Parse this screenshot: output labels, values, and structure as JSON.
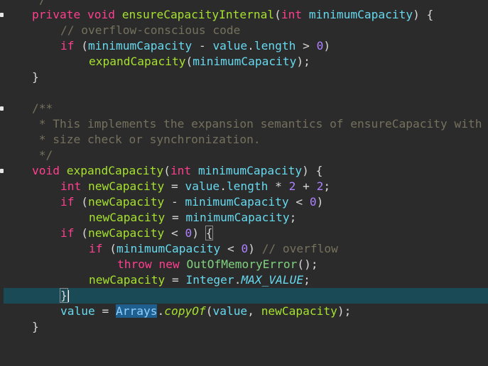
{
  "editor": {
    "lines": [
      "/",
      "private void ensureCapacityInternal(int minimumCapacity) {",
      "// overflow-conscious code",
      "if (minimumCapacity - value.length > 0)",
      "expandCapacity(minimumCapacity);",
      "}",
      "",
      "/**",
      "* This implements the expansion semantics of ensureCapacity with",
      "* size check or synchronization.",
      "*/",
      "void expandCapacity(int minimumCapacity) {",
      "int newCapacity = value.length * 2 + 2;",
      "if (newCapacity - minimumCapacity < 0)",
      "newCapacity = minimumCapacity;",
      "if (newCapacity < 0) {",
      "if (minimumCapacity < 0) // overflow",
      "throw new OutOfMemoryError();",
      "newCapacity = Integer.MAX_VALUE;",
      "}",
      "value = Arrays.copyOf(value, newCapacity);",
      "}"
    ],
    "tokens": {
      "private": "private",
      "void": "void",
      "int": "int",
      "if": "if",
      "throw": "throw",
      "new": "new",
      "ensureCapacityInternal": "ensureCapacityInternal",
      "minimumCapacity": "minimumCapacity",
      "comment_overflow_conscious": "// overflow-conscious code",
      "value": "value",
      "length": "length",
      "zero": "0",
      "expandCapacity": "expandCapacity",
      "doc_open": "/**",
      "doc_line1": " * This implements the expansion semantics of ensureCapacity with",
      "doc_line2": " * size check or synchronization.",
      "doc_close": " */",
      "newCapacity": "newCapacity",
      "two": "2",
      "comment_overflow": "// overflow",
      "OutOfMemoryError": "OutOfMemoryError",
      "Integer": "Integer",
      "MAX_VALUE": "MAX_VALUE",
      "Arrays": "Arrays",
      "copyOf": "copyOf",
      "top_fragment": "/"
    },
    "colors": {
      "background": "#2b2b2b",
      "keyword": "#ff3f8f",
      "method": "#a6e22e",
      "field": "#66d9ef",
      "number": "#ae81ff",
      "comment": "#75715e",
      "current_line": "#1a4a55",
      "selection": "#1f5f8f"
    },
    "current_line_index": 19,
    "folding_marker_lines": [
      1,
      7,
      11
    ]
  }
}
